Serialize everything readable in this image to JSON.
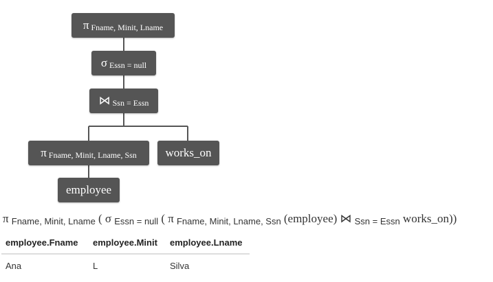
{
  "tree": {
    "projection": {
      "symbol": "π",
      "attrs": "Fname, Minit, Lname"
    },
    "selection": {
      "symbol": "σ",
      "condition": "Essn = null"
    },
    "join": {
      "symbol": "⋈",
      "condition": "Ssn = Essn"
    },
    "inner_projection": {
      "symbol": "π",
      "attrs": "Fname, Minit, Lname, Ssn"
    },
    "works_on": {
      "label": "works_on"
    },
    "employee": {
      "label": "employee"
    }
  },
  "expression": {
    "pi1": "π",
    "pi1_sub": "Fname, Minit, Lname",
    "open1": "(",
    "sigma": "σ",
    "sigma_sub": "Essn = null",
    "open2": "(",
    "pi2": "π",
    "pi2_sub": "Fname, Minit, Lname, Ssn",
    "rel1": "(employee)",
    "join": "⋈",
    "join_sub": "Ssn = Essn",
    "rel2": "works_on",
    "close": "))"
  },
  "result": {
    "columns": [
      "employee.Fname",
      "employee.Minit",
      "employee.Lname"
    ],
    "rows": [
      [
        "Ana",
        "L",
        "Silva"
      ]
    ]
  },
  "colors": {
    "node_bg": "#555555",
    "node_text": "#ffffff",
    "edge": "#555555"
  }
}
